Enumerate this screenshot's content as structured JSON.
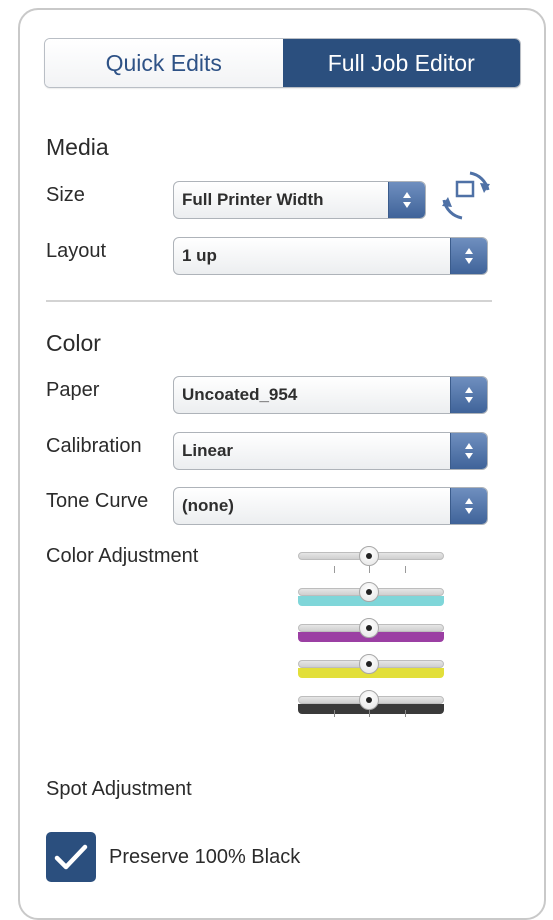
{
  "tabs": {
    "quick_edits": "Quick Edits",
    "full_job_editor": "Full Job Editor"
  },
  "media": {
    "title": "Media",
    "size_label": "Size",
    "size_value": "Full Printer Width",
    "layout_label": "Layout",
    "layout_value": "1 up"
  },
  "color": {
    "title": "Color",
    "paper_label": "Paper",
    "paper_value": "Uncoated_954",
    "calibration_label": "Calibration",
    "calibration_value": "Linear",
    "tone_curve_label": "Tone Curve",
    "tone_curve_value": "(none)",
    "adjustment_label": "Color Adjustment",
    "adjustment_sliders": [
      {
        "channel": "neutral",
        "color": "#cfcfcf",
        "value": 0.5
      },
      {
        "channel": "cyan",
        "color": "#7fd6d9",
        "value": 0.5
      },
      {
        "channel": "magenta",
        "color": "#9b3fa3",
        "value": 0.5
      },
      {
        "channel": "yellow",
        "color": "#e2df3a",
        "value": 0.5
      },
      {
        "channel": "black",
        "color": "#3a3a3a",
        "value": 0.5
      }
    ]
  },
  "spot": {
    "label": "Spot Adjustment"
  },
  "preserve": {
    "label": "Preserve 100% Black",
    "checked": true
  },
  "colors": {
    "accent": "#2b4f7e",
    "select_arrow": "#4f71a6"
  },
  "icons": {
    "rotate": "rotate-orientation-icon",
    "check": "checkmark-icon",
    "select": "up-down-arrows-icon"
  }
}
